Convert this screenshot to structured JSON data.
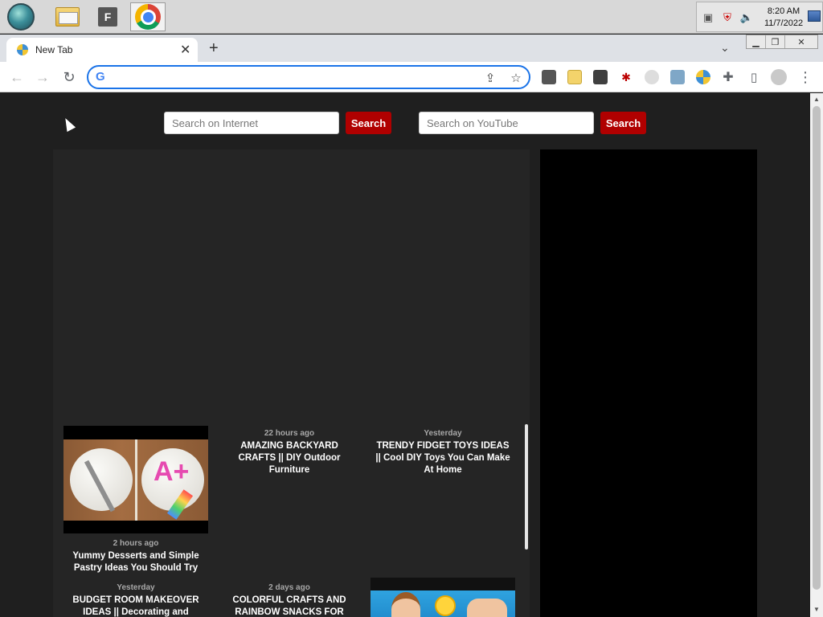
{
  "taskbar": {
    "clock_time": "8:20 AM",
    "clock_date": "11/7/2022",
    "f_app_label": "F"
  },
  "browser": {
    "tab_title": "New Tab",
    "new_tab_symbol": "+",
    "close_symbol": "✕",
    "address_value": ""
  },
  "page": {
    "internet_search_placeholder": "Search on Internet",
    "internet_search_button": "Search",
    "youtube_search_placeholder": "Search on YouTube",
    "youtube_search_button": "Search",
    "cards": [
      {
        "time": "2 hours ago",
        "title": "Yummy Desserts and Simple Pastry Ideas You Should Try"
      },
      {
        "time": "22 hours ago",
        "title": "AMAZING BACKYARD CRAFTS || DIY Outdoor Furniture"
      },
      {
        "time": "Yesterday",
        "title": "TRENDY FIDGET TOYS IDEAS || Cool DIY Toys You Can Make At Home"
      },
      {
        "time": "Yesterday",
        "title": "BUDGET ROOM MAKEOVER IDEAS || Decorating and"
      },
      {
        "time": "2 days ago",
        "title": "COLORFUL CRAFTS AND RAINBOW SNACKS FOR"
      }
    ]
  }
}
